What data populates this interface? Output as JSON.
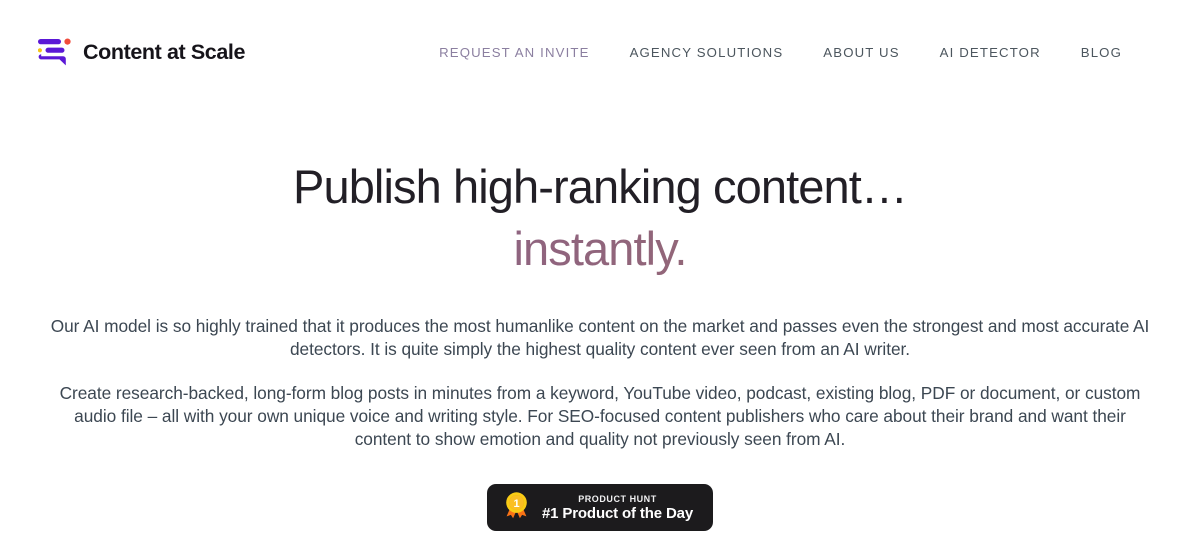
{
  "header": {
    "brand": {
      "name": "Content at Scale",
      "logo_icon": "content-at-scale-bars-logo",
      "bar_color": "#5b18d6",
      "dot_color": "#f04b3c",
      "accent_color": "#f5c518"
    },
    "nav": [
      {
        "label": "REQUEST AN INVITE",
        "name": "request-an-invite",
        "muted": true
      },
      {
        "label": "AGENCY SOLUTIONS",
        "name": "agency-solutions",
        "muted": false
      },
      {
        "label": "ABOUT US",
        "name": "about-us",
        "muted": false
      },
      {
        "label": "AI DETECTOR",
        "name": "ai-detector",
        "muted": false
      },
      {
        "label": "BLOG",
        "name": "blog",
        "muted": false
      }
    ]
  },
  "hero": {
    "title_line_1": "Publish high-ranking content…",
    "title_line_2": "instantly.",
    "gradient_start": "#8a5f93",
    "gradient_end": "#9a6a62",
    "paragraph_1": "Our AI model is so highly trained that it produces the most humanlike content on the market and passes even the strongest and most accurate AI detectors. It is quite simply the highest quality content ever seen from an AI writer.",
    "paragraph_2": "Create research-backed, long-form blog posts in minutes from a keyword, YouTube video, podcast, existing blog, PDF or document, or custom audio file – all with your own unique voice and writing style. For SEO-focused content publishers who care about their brand and want their content to show emotion and quality not previously seen from AI."
  },
  "product_hunt_badge": {
    "eyebrow": "PRODUCT HUNT",
    "headline": "#1 Product of the Day",
    "medal_icon": "gold-medal-icon",
    "medal_number": "1",
    "background_color": "#1c1b1d",
    "medal_color": "#facc15",
    "ribbon_color": "#f97316"
  }
}
